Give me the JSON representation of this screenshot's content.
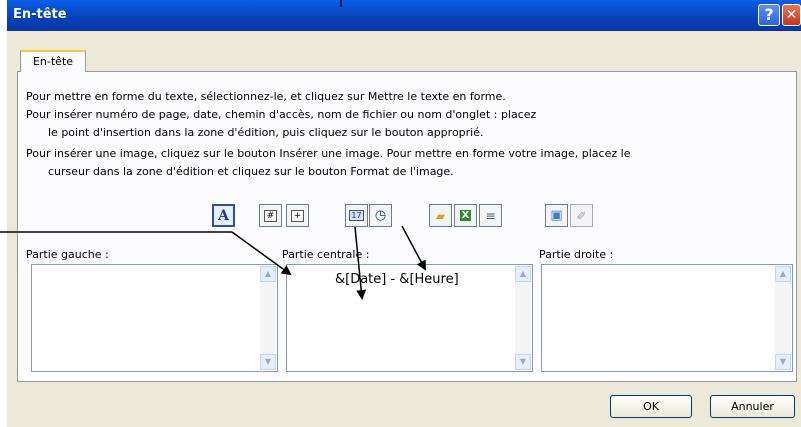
{
  "window": {
    "title": "En-tête",
    "help_label": "?",
    "close_label": "✕"
  },
  "tab": {
    "label": "En-tête"
  },
  "instructions": [
    "Pour mettre en forme du texte, sélectionnez-le, et cliquez sur Mettre le texte en forme.",
    "Pour insérer numéro de page, date, chemin  d'accès, nom de fichier ou nom d'onglet  : placez",
    "le point d'insertion dans la zone d'édition, puis cliquez sur le bouton approprié.",
    "Pour insérer une image, cliquez sur le bouton Insérer une image. Pour mettre en forme votre image, placez le",
    "curseur dans la zone d'édition et cliquez sur le bouton Format de l'image."
  ],
  "toolbar": [
    {
      "icon": "text-format-icon",
      "glyph": "A"
    },
    {
      "icon": "page-number-icon",
      "glyph": "#"
    },
    {
      "icon": "page-count-icon",
      "glyph": "+"
    },
    {
      "icon": "date-icon",
      "glyph": "17"
    },
    {
      "icon": "time-icon",
      "glyph": "◷"
    },
    {
      "icon": "file-path-icon",
      "glyph": "▰"
    },
    {
      "icon": "file-name-icon",
      "glyph": "X"
    },
    {
      "icon": "sheet-name-icon",
      "glyph": "≡"
    },
    {
      "icon": "insert-picture-icon",
      "glyph": "▣"
    },
    {
      "icon": "format-picture-icon",
      "glyph": "✐"
    }
  ],
  "sections": {
    "left": {
      "label": "Partie gauche :",
      "text": ""
    },
    "center": {
      "label": "Partie centrale :",
      "text": "&[Date] - &[Heure]"
    },
    "right": {
      "label": "Partie droite :",
      "text": ""
    }
  },
  "buttons": {
    "ok": "OK",
    "cancel": "Annuler"
  }
}
